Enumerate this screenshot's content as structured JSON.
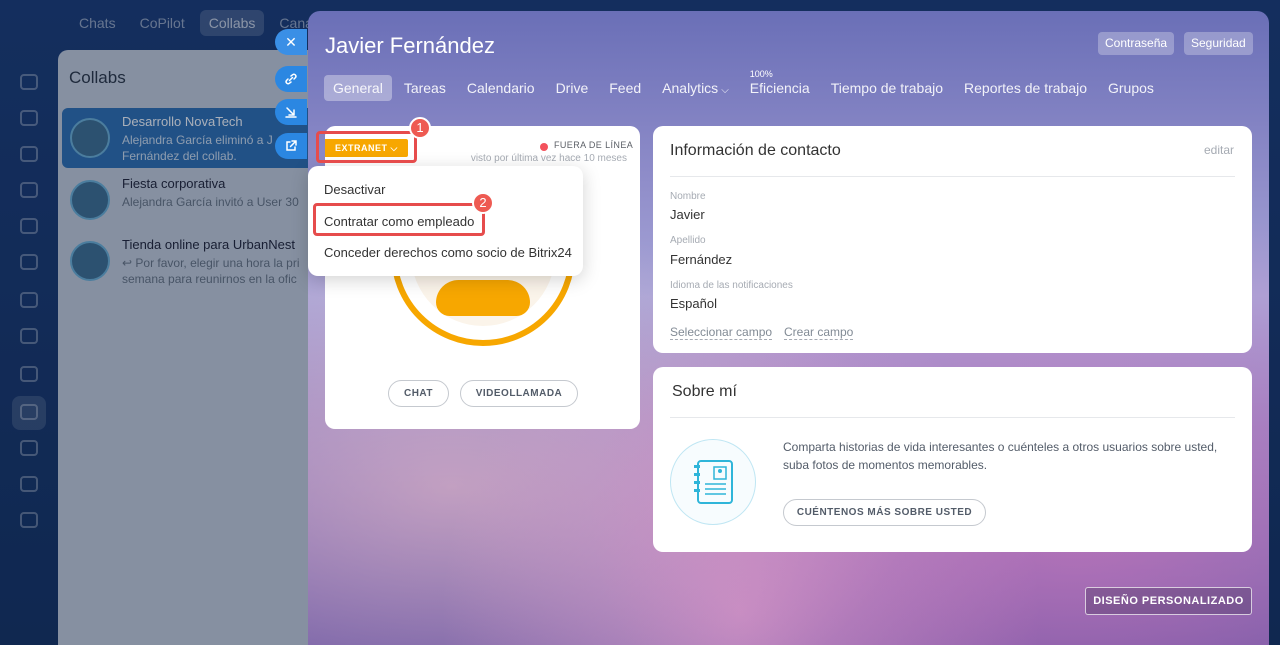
{
  "background": {
    "top_tabs": [
      "Chats",
      "CoPilot",
      "Collabs",
      "Canales"
    ],
    "collabs_title": "Collabs",
    "collabs": [
      {
        "name": "Desarrollo NovaTech",
        "sub": "Alejandra García eliminó a Javier Fernández del collab.",
        "sub_line1": "Alejandra García eliminó a J",
        "sub_line2": "Fernández del collab."
      },
      {
        "name": "Fiesta corporativa",
        "sub_line1": "Alejandra García invitó a User 30",
        "sub_line2": ""
      },
      {
        "name": "Tienda online para UrbanNest",
        "sub_line1": "↩ Por favor, elegir una hora la pri",
        "sub_line2": "semana para reunirnos en la ofic"
      }
    ]
  },
  "profile": {
    "name": "Javier Fernández",
    "header_buttons": {
      "password": "Contraseña",
      "security": "Seguridad"
    },
    "tabs": [
      "General",
      "Tareas",
      "Calendario",
      "Drive",
      "Feed",
      "Analytics",
      "Eficiencia",
      "Tiempo de trabajo",
      "Reportes de trabajo",
      "Grupos"
    ],
    "efficiency_badge": "100%",
    "card": {
      "extranet_label": "EXTRANET",
      "status": "FUERA DE LÍNEA",
      "last_seen": "visto por última vez hace 10 meses",
      "chat_btn": "CHAT",
      "video_btn": "VIDEOLLAMADA"
    },
    "menu": [
      "Desactivar",
      "Contratar como empleado",
      "Conceder derechos como socio de Bitrix24"
    ],
    "contact": {
      "title": "Información de contacto",
      "edit": "editar",
      "fields": [
        {
          "label": "Nombre",
          "value": "Javier"
        },
        {
          "label": "Apellido",
          "value": "Fernández"
        },
        {
          "label": "Idioma de las notificaciones",
          "value": "Español"
        }
      ],
      "select_field": "Seleccionar campo",
      "create_field": "Crear campo"
    },
    "about": {
      "title": "Sobre mí",
      "text": "Comparta historias de vida interesantes o cuénteles a otros usuarios sobre usted, suba fotos de momentos memorables.",
      "button": "CUÉNTENOS MÁS SOBRE USTED"
    },
    "design_button": "DISEÑO PERSONALIZADO"
  },
  "annotations": {
    "step1": "1",
    "step2": "2",
    "highlight_color": "#e64c4c"
  },
  "colors": {
    "accent": "#2b87e2",
    "extranet": "#f7a700",
    "offline": "#f3525c"
  },
  "icons": [
    "close-icon",
    "link-icon",
    "download-icon",
    "external-link-icon",
    "chevron-down-icon",
    "contact-card-icon"
  ]
}
